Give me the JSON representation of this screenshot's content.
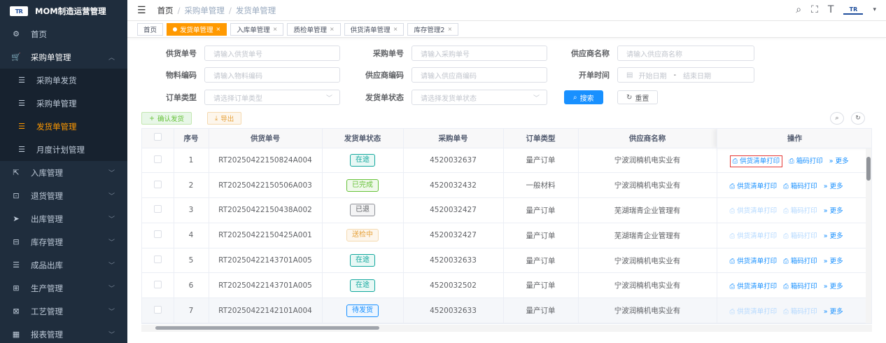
{
  "brand": {
    "logo": "TR",
    "title": "MOM制造运营管理"
  },
  "sidebar": {
    "items": [
      {
        "icon": "⚙",
        "icon_name": "dashboard-icon",
        "label": "首页",
        "arrow": false
      },
      {
        "icon": "🛒",
        "icon_name": "cart-icon",
        "label": "采购单管理",
        "arrow": true,
        "open": true
      },
      {
        "icon": "☰",
        "icon_name": "list-icon",
        "label": "采购单发货",
        "sub": true
      },
      {
        "icon": "☰",
        "icon_name": "list-icon",
        "label": "采购单管理",
        "sub": true
      },
      {
        "icon": "☰",
        "icon_name": "list-icon",
        "label": "发货单管理",
        "sub": true,
        "active": true
      },
      {
        "icon": "☰",
        "icon_name": "list-icon",
        "label": "月度计划管理",
        "sub": true
      },
      {
        "icon": "⇱",
        "icon_name": "inbound-icon",
        "label": "入库管理",
        "arrow": true
      },
      {
        "icon": "⊡",
        "icon_name": "return-icon",
        "label": "退货管理",
        "arrow": true
      },
      {
        "icon": "➤",
        "icon_name": "outbound-icon",
        "label": "出库管理",
        "arrow": true
      },
      {
        "icon": "⊟",
        "icon_name": "inventory-icon",
        "label": "库存管理",
        "arrow": true
      },
      {
        "icon": "☰",
        "icon_name": "product-out-icon",
        "label": "成品出库",
        "arrow": true
      },
      {
        "icon": "⊞",
        "icon_name": "production-icon",
        "label": "生产管理",
        "arrow": true
      },
      {
        "icon": "⊠",
        "icon_name": "process-icon",
        "label": "工艺管理",
        "arrow": true
      },
      {
        "icon": "▦",
        "icon_name": "report-icon",
        "label": "报表管理",
        "arrow": true
      }
    ]
  },
  "breadcrumb": [
    "首页",
    "采购单管理",
    "发货单管理"
  ],
  "navbar": {
    "logo": "TR"
  },
  "tags": [
    {
      "label": "首页",
      "active": false,
      "closable": false
    },
    {
      "label": "发货单管理",
      "active": true,
      "closable": true
    },
    {
      "label": "入库单管理",
      "active": false,
      "closable": true
    },
    {
      "label": "质检单管理",
      "active": false,
      "closable": true
    },
    {
      "label": "供货清单管理",
      "active": false,
      "closable": true
    },
    {
      "label": "库存管理2",
      "active": false,
      "closable": true
    }
  ],
  "form": {
    "supply_no": {
      "label": "供货单号",
      "placeholder": "请输入供货单号"
    },
    "purchase_no": {
      "label": "采购单号",
      "placeholder": "请输入采购单号"
    },
    "supplier_name": {
      "label": "供应商名称",
      "placeholder": "请输入供应商名称"
    },
    "material_code": {
      "label": "物料编码",
      "placeholder": "请输入物料编码"
    },
    "supplier_code": {
      "label": "供应商编码",
      "placeholder": "请输入供应商编码"
    },
    "open_time": {
      "label": "开单时间",
      "start": "开始日期",
      "dash": "-",
      "end": "结束日期"
    },
    "order_type": {
      "label": "订单类型",
      "placeholder": "请选择订单类型"
    },
    "ship_status": {
      "label": "发货单状态",
      "placeholder": "请选择发货单状态"
    },
    "search_btn": "搜索",
    "reset_btn": "重置"
  },
  "toolbar": {
    "confirm": "确认发货",
    "export": "导出"
  },
  "table": {
    "headers": [
      "序号",
      "供货单号",
      "发货单状态",
      "采购单号",
      "订单类型",
      "供应商名称",
      "操作"
    ],
    "op_labels": {
      "print_list": "供货清单打印",
      "print_box": "箱码打印",
      "more": "更多"
    },
    "rows": [
      {
        "idx": "1",
        "no": "RT20250422150824A004",
        "status": "在途",
        "stype": "green",
        "po": "4520032637",
        "otype": "量产订单",
        "supplier": "宁波润楠机电实业有",
        "ops_disabled": false,
        "highlight_first": true
      },
      {
        "idx": "2",
        "no": "RT20250422150506A003",
        "status": "已完成",
        "stype": "done",
        "po": "4520032432",
        "otype": "一般材料",
        "supplier": "宁波润楠机电实业有",
        "ops_disabled": false
      },
      {
        "idx": "3",
        "no": "RT20250422150438A002",
        "status": "已退",
        "stype": "grey",
        "po": "4520032427",
        "otype": "量产订单",
        "supplier": "芜湖瑞青企业管理有",
        "ops_disabled": true
      },
      {
        "idx": "4",
        "no": "RT20250422150425A001",
        "status": "送检中",
        "stype": "orange",
        "po": "4520032427",
        "otype": "量产订单",
        "supplier": "芜湖瑞青企业管理有",
        "ops_disabled": true
      },
      {
        "idx": "5",
        "no": "RT20250422143701A005",
        "status": "在途",
        "stype": "green",
        "po": "4520032633",
        "otype": "量产订单",
        "supplier": "宁波润楠机电实业有",
        "ops_disabled": false
      },
      {
        "idx": "6",
        "no": "RT20250422143701A005",
        "status": "在途",
        "stype": "green",
        "po": "4520032502",
        "otype": "量产订单",
        "supplier": "宁波润楠机电实业有",
        "ops_disabled": false
      },
      {
        "idx": "7",
        "no": "RT20250422142101A004",
        "status": "待发货",
        "stype": "blue",
        "po": "4520032633",
        "otype": "量产订单",
        "supplier": "宁波润楠机电实业有",
        "ops_disabled": true,
        "row_hl": true
      }
    ]
  }
}
